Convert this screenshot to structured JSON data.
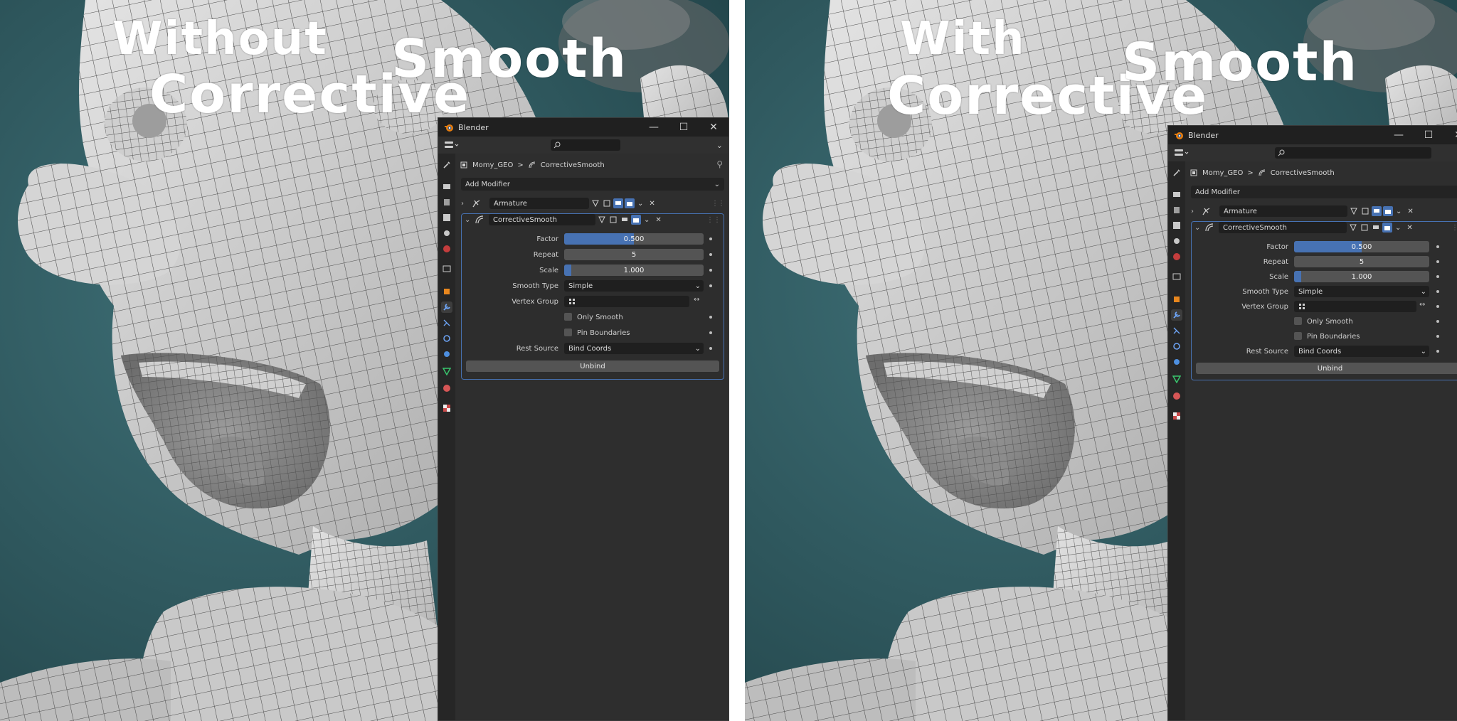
{
  "colors": {
    "viewport_bg": "#2a5358",
    "mesh": "#d8d8d8",
    "wire": "#5a5a5a",
    "window_bg": "#2c2c2c",
    "accent": "#4772b3",
    "caption": "#ffffff"
  },
  "panels": [
    {
      "caption": [
        "Without",
        "Corrective",
        "Smooth"
      ],
      "window": {
        "app_title": "Blender",
        "window_buttons": [
          "minimize-icon",
          "maximize-icon",
          "close-icon"
        ],
        "breadcrumb": {
          "object": "Momy_GEO",
          "separator": ">",
          "modifier": "CorrectiveSmooth"
        },
        "add_modifier": "Add Modifier",
        "modifiers": [
          {
            "name": "Armature",
            "expanded": false,
            "icon": "armature-icon"
          },
          {
            "name": "CorrectiveSmooth",
            "expanded": true,
            "icon": "corrective-smooth-icon"
          }
        ],
        "properties": {
          "factor_label": "Factor",
          "factor_value": "0.500",
          "factor_fill": 0.5,
          "repeat_label": "Repeat",
          "repeat_value": "5",
          "scale_label": "Scale",
          "scale_value": "1.000",
          "scale_fill": 0.05,
          "smooth_type_label": "Smooth Type",
          "smooth_type_value": "Simple",
          "vertex_group_label": "Vertex Group",
          "vertex_group_value": "",
          "only_smooth_label": "Only Smooth",
          "only_smooth_checked": false,
          "pin_boundaries_label": "Pin Boundaries",
          "pin_boundaries_checked": false,
          "rest_source_label": "Rest Source",
          "rest_source_value": "Bind Coords",
          "unbind_label": "Unbind"
        }
      }
    },
    {
      "caption": [
        "With",
        "Corrective",
        "Smooth"
      ],
      "window": {
        "app_title": "Blender",
        "window_buttons": [
          "minimize-icon",
          "maximize-icon",
          "close-icon"
        ],
        "breadcrumb": {
          "object": "Momy_GEO",
          "separator": ">",
          "modifier": "CorrectiveSmooth"
        },
        "add_modifier": "Add Modifier",
        "modifiers": [
          {
            "name": "Armature",
            "expanded": false,
            "icon": "armature-icon"
          },
          {
            "name": "CorrectiveSmooth",
            "expanded": true,
            "icon": "corrective-smooth-icon"
          }
        ],
        "properties": {
          "factor_label": "Factor",
          "factor_value": "0.500",
          "factor_fill": 0.5,
          "repeat_label": "Repeat",
          "repeat_value": "5",
          "scale_label": "Scale",
          "scale_value": "1.000",
          "scale_fill": 0.05,
          "smooth_type_label": "Smooth Type",
          "smooth_type_value": "Simple",
          "vertex_group_label": "Vertex Group",
          "vertex_group_value": "",
          "only_smooth_label": "Only Smooth",
          "only_smooth_checked": false,
          "pin_boundaries_label": "Pin Boundaries",
          "pin_boundaries_checked": false,
          "rest_source_label": "Rest Source",
          "rest_source_value": "Bind Coords",
          "unbind_label": "Unbind"
        }
      }
    }
  ]
}
